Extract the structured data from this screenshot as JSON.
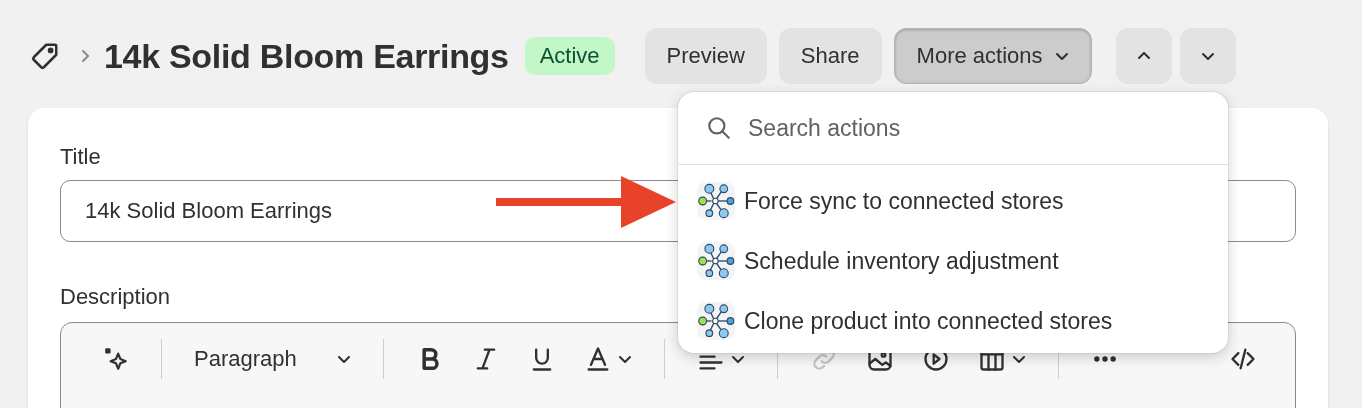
{
  "header": {
    "title": "14k Solid Bloom Earrings",
    "status": "Active",
    "buttons": [
      {
        "label": "Preview"
      },
      {
        "label": "Share"
      }
    ],
    "more_actions": {
      "label": "More actions",
      "expanded": true
    }
  },
  "actions_menu": {
    "search": {
      "placeholder": "Search actions"
    },
    "items": [
      {
        "label": "Force sync to connected stores"
      },
      {
        "label": "Schedule inventory adjustment"
      },
      {
        "label": "Clone product into connected stores"
      }
    ]
  },
  "form": {
    "title_label": "Title",
    "title_value": "14k Solid Bloom Earrings",
    "description_label": "Description",
    "toolbar": {
      "block_format": "Paragraph",
      "link_disabled": true
    }
  }
}
